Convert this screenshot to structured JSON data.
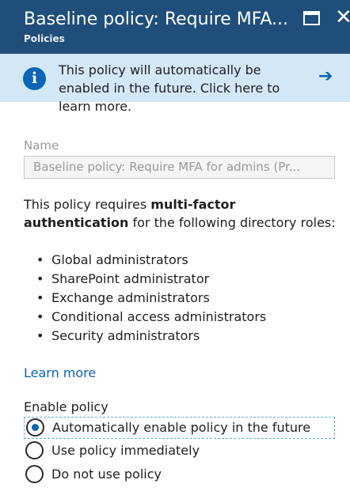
{
  "header": {
    "title": "Baseline policy: Require MFA...",
    "subtitle": "Policies",
    "maximize_icon": "maximize-icon",
    "close_icon": "close-icon"
  },
  "info_banner": {
    "icon": "info-icon",
    "text": "This policy will automatically be enabled in the future. Click here to learn more.",
    "arrow_icon": "arrow-right-icon"
  },
  "name_field": {
    "label": "Name",
    "value": "Baseline policy: Require MFA for admins (Pr..."
  },
  "description": {
    "prefix": "This policy requires ",
    "bold": "multi-factor authentication",
    "suffix": " for the following directory roles:"
  },
  "roles": [
    "Global administrators",
    "SharePoint administrator",
    "Exchange administrators",
    "Conditional access administrators",
    "Security administrators"
  ],
  "learn_more": "Learn more",
  "enable_policy": {
    "label": "Enable policy",
    "options": [
      {
        "label": "Automatically enable policy in the future",
        "selected": true
      },
      {
        "label": "Use policy immediately",
        "selected": false
      },
      {
        "label": "Do not use policy",
        "selected": false
      }
    ]
  },
  "colors": {
    "header_bg": "#1f4e7a",
    "banner_bg": "#d4e7f7",
    "accent": "#0a64b8"
  }
}
